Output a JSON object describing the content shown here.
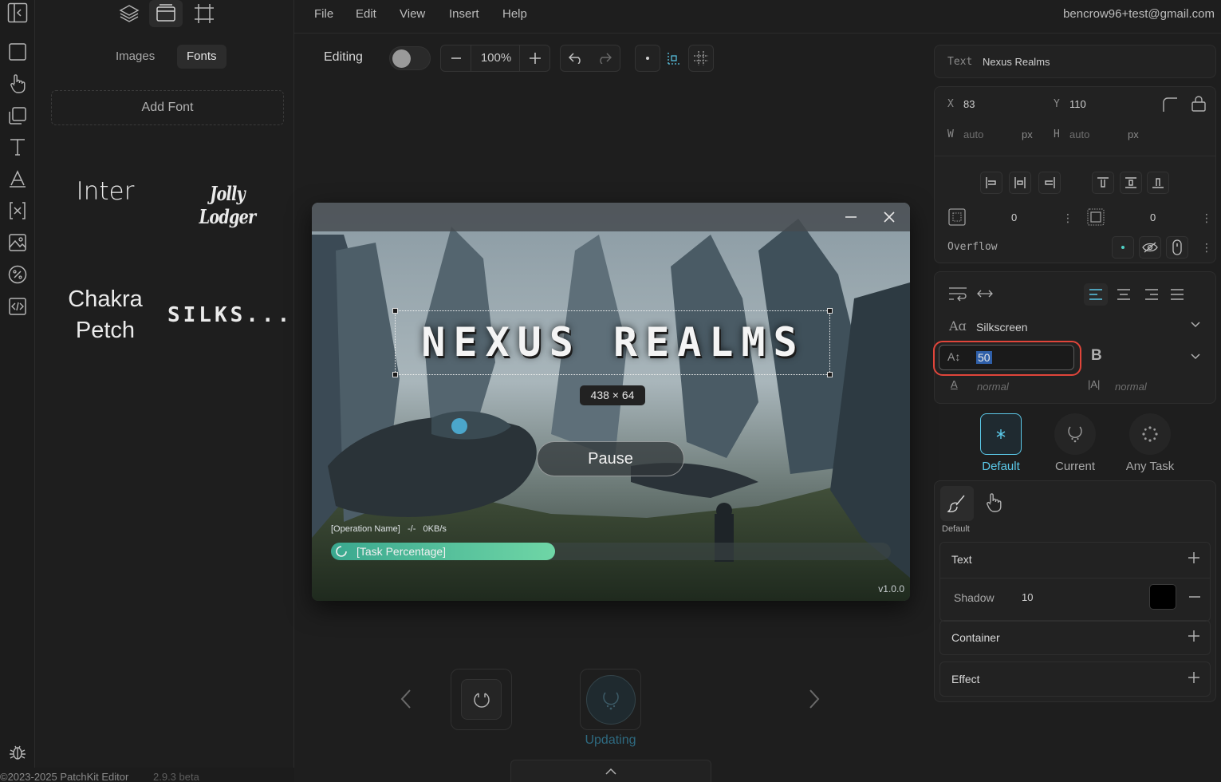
{
  "menu": {
    "items": [
      "File",
      "Edit",
      "View",
      "Insert",
      "Help"
    ],
    "user_email": "bencrow96+test@gmail.com"
  },
  "left_panel": {
    "tabs": {
      "images": "Images",
      "fonts": "Fonts"
    },
    "add_font_label": "Add Font",
    "fonts": [
      "Inter",
      "Jolly Lodger",
      "Chakra\nPetch",
      "SILKS..."
    ]
  },
  "toolbar": {
    "mode_label": "Editing",
    "zoom": "100%"
  },
  "canvas": {
    "title_text": "NEXUS REALMS",
    "size_badge": "438 × 64",
    "pause_label": "Pause",
    "operation_text": "[Operation Name]   -/-   0KB/s",
    "task_text": "[Task Percentage]",
    "version": "v1.0.0",
    "progress_fraction": 0.4,
    "bottom_state_label": "Updating"
  },
  "properties": {
    "text_label": "Text",
    "text_value": "Nexus Realms",
    "x_label": "X",
    "x_value": "83",
    "y_label": "Y",
    "y_value": "110",
    "w_label": "W",
    "w_value": "auto",
    "w_unit": "px",
    "h_label": "H",
    "h_value": "auto",
    "h_unit": "px",
    "padding_value": "0",
    "margin_value": "0",
    "overflow_label": "Overflow",
    "font_family": "Silkscreen",
    "font_size": "50",
    "bold_label": "B",
    "letter_spacing": "normal",
    "line_height": "normal",
    "states": [
      "Default",
      "Current",
      "Any Task"
    ],
    "interaction_default_label": "Default",
    "sections": {
      "text": "Text",
      "shadow_label": "Shadow",
      "shadow_value": "10",
      "container": "Container",
      "effect": "Effect"
    }
  },
  "footer": {
    "copyright": "©2023-2025 PatchKit Editor",
    "version": "2.9.3 beta"
  },
  "colors": {
    "accent": "#4fd1c5",
    "highlight_ring": "#e0453a",
    "active_state": "#5bc8e8"
  }
}
